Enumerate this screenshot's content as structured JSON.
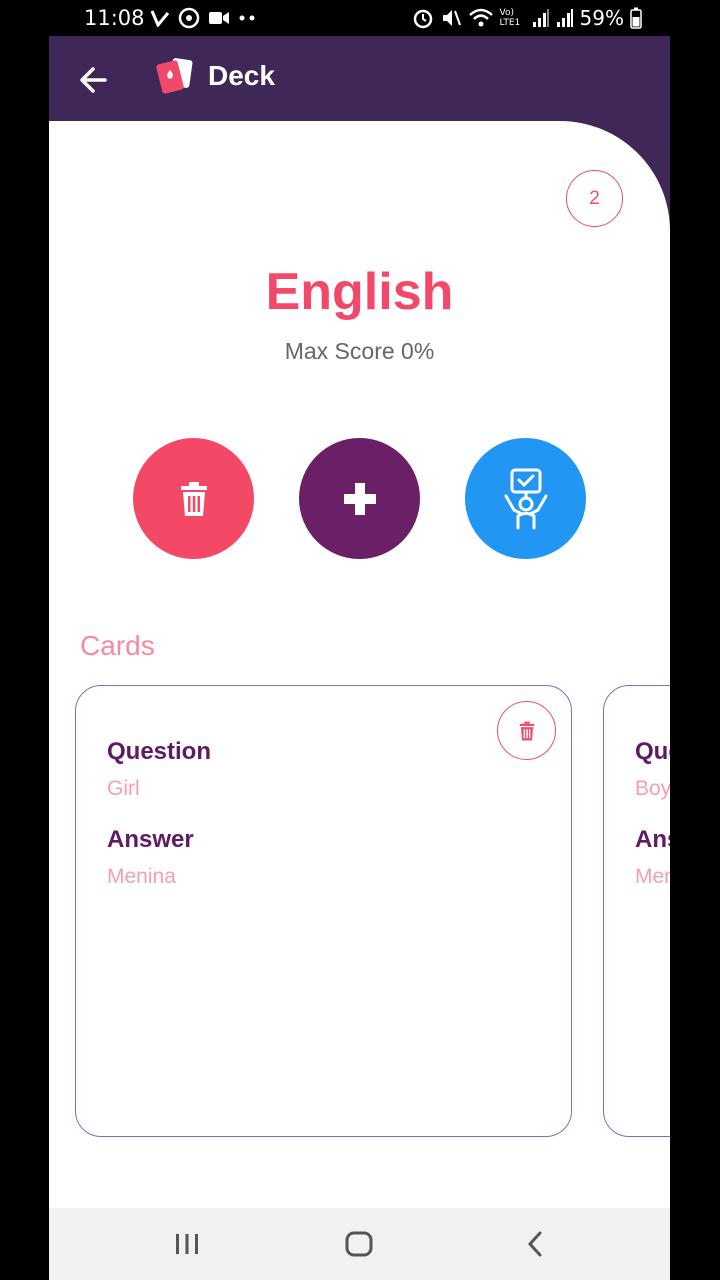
{
  "status_bar": {
    "time": "11:08",
    "battery": "59%",
    "network_label": "Vo) LTE1"
  },
  "app_bar": {
    "title": "Deck",
    "back_icon": "arrow-left-icon",
    "logo_icon": "playing-cards-icon"
  },
  "deck": {
    "name": "English",
    "max_score": "Max Score 0%",
    "card_count": "2"
  },
  "actions": {
    "delete_icon": "trash-icon",
    "add_icon": "plus-icon",
    "study_icon": "quiz-person-icon"
  },
  "cards_section": {
    "label": "Cards",
    "cards": [
      {
        "question_label": "Question",
        "question": "Girl",
        "answer_label": "Answer",
        "answer": "Menina"
      },
      {
        "question_label": "Question",
        "question": "Boy",
        "answer_label": "Answer",
        "answer": "Menino"
      }
    ]
  },
  "colors": {
    "app_bar": "#3f2857",
    "accent_pink": "#f2496a",
    "accent_purple": "#6a1f67",
    "accent_blue": "#2196f3"
  }
}
